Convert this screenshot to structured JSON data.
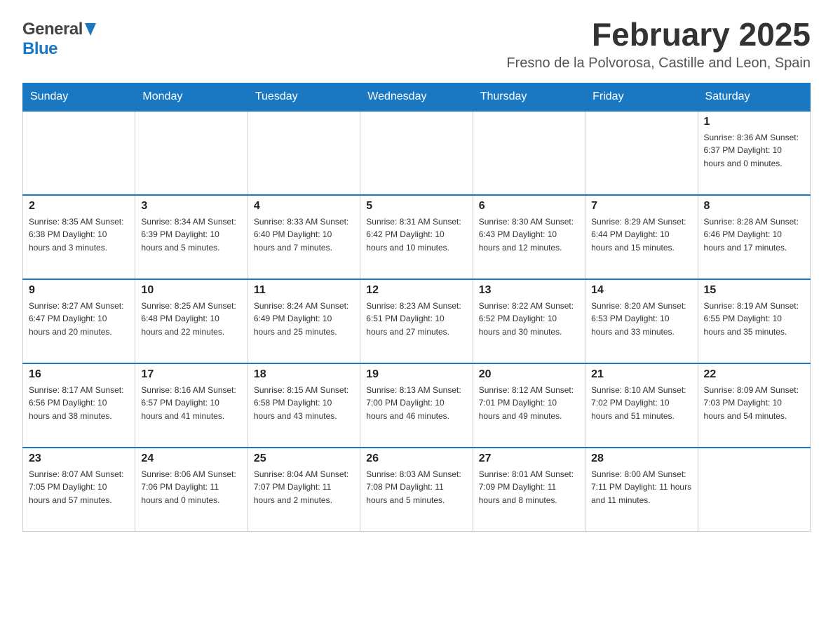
{
  "header": {
    "logo_general": "General",
    "logo_blue": "Blue",
    "month_title": "February 2025",
    "location": "Fresno de la Polvorosa, Castille and Leon, Spain"
  },
  "weekdays": [
    "Sunday",
    "Monday",
    "Tuesday",
    "Wednesday",
    "Thursday",
    "Friday",
    "Saturday"
  ],
  "weeks": [
    [
      {
        "day": "",
        "info": ""
      },
      {
        "day": "",
        "info": ""
      },
      {
        "day": "",
        "info": ""
      },
      {
        "day": "",
        "info": ""
      },
      {
        "day": "",
        "info": ""
      },
      {
        "day": "",
        "info": ""
      },
      {
        "day": "1",
        "info": "Sunrise: 8:36 AM\nSunset: 6:37 PM\nDaylight: 10 hours and 0 minutes."
      }
    ],
    [
      {
        "day": "2",
        "info": "Sunrise: 8:35 AM\nSunset: 6:38 PM\nDaylight: 10 hours and 3 minutes."
      },
      {
        "day": "3",
        "info": "Sunrise: 8:34 AM\nSunset: 6:39 PM\nDaylight: 10 hours and 5 minutes."
      },
      {
        "day": "4",
        "info": "Sunrise: 8:33 AM\nSunset: 6:40 PM\nDaylight: 10 hours and 7 minutes."
      },
      {
        "day": "5",
        "info": "Sunrise: 8:31 AM\nSunset: 6:42 PM\nDaylight: 10 hours and 10 minutes."
      },
      {
        "day": "6",
        "info": "Sunrise: 8:30 AM\nSunset: 6:43 PM\nDaylight: 10 hours and 12 minutes."
      },
      {
        "day": "7",
        "info": "Sunrise: 8:29 AM\nSunset: 6:44 PM\nDaylight: 10 hours and 15 minutes."
      },
      {
        "day": "8",
        "info": "Sunrise: 8:28 AM\nSunset: 6:46 PM\nDaylight: 10 hours and 17 minutes."
      }
    ],
    [
      {
        "day": "9",
        "info": "Sunrise: 8:27 AM\nSunset: 6:47 PM\nDaylight: 10 hours and 20 minutes."
      },
      {
        "day": "10",
        "info": "Sunrise: 8:25 AM\nSunset: 6:48 PM\nDaylight: 10 hours and 22 minutes."
      },
      {
        "day": "11",
        "info": "Sunrise: 8:24 AM\nSunset: 6:49 PM\nDaylight: 10 hours and 25 minutes."
      },
      {
        "day": "12",
        "info": "Sunrise: 8:23 AM\nSunset: 6:51 PM\nDaylight: 10 hours and 27 minutes."
      },
      {
        "day": "13",
        "info": "Sunrise: 8:22 AM\nSunset: 6:52 PM\nDaylight: 10 hours and 30 minutes."
      },
      {
        "day": "14",
        "info": "Sunrise: 8:20 AM\nSunset: 6:53 PM\nDaylight: 10 hours and 33 minutes."
      },
      {
        "day": "15",
        "info": "Sunrise: 8:19 AM\nSunset: 6:55 PM\nDaylight: 10 hours and 35 minutes."
      }
    ],
    [
      {
        "day": "16",
        "info": "Sunrise: 8:17 AM\nSunset: 6:56 PM\nDaylight: 10 hours and 38 minutes."
      },
      {
        "day": "17",
        "info": "Sunrise: 8:16 AM\nSunset: 6:57 PM\nDaylight: 10 hours and 41 minutes."
      },
      {
        "day": "18",
        "info": "Sunrise: 8:15 AM\nSunset: 6:58 PM\nDaylight: 10 hours and 43 minutes."
      },
      {
        "day": "19",
        "info": "Sunrise: 8:13 AM\nSunset: 7:00 PM\nDaylight: 10 hours and 46 minutes."
      },
      {
        "day": "20",
        "info": "Sunrise: 8:12 AM\nSunset: 7:01 PM\nDaylight: 10 hours and 49 minutes."
      },
      {
        "day": "21",
        "info": "Sunrise: 8:10 AM\nSunset: 7:02 PM\nDaylight: 10 hours and 51 minutes."
      },
      {
        "day": "22",
        "info": "Sunrise: 8:09 AM\nSunset: 7:03 PM\nDaylight: 10 hours and 54 minutes."
      }
    ],
    [
      {
        "day": "23",
        "info": "Sunrise: 8:07 AM\nSunset: 7:05 PM\nDaylight: 10 hours and 57 minutes."
      },
      {
        "day": "24",
        "info": "Sunrise: 8:06 AM\nSunset: 7:06 PM\nDaylight: 11 hours and 0 minutes."
      },
      {
        "day": "25",
        "info": "Sunrise: 8:04 AM\nSunset: 7:07 PM\nDaylight: 11 hours and 2 minutes."
      },
      {
        "day": "26",
        "info": "Sunrise: 8:03 AM\nSunset: 7:08 PM\nDaylight: 11 hours and 5 minutes."
      },
      {
        "day": "27",
        "info": "Sunrise: 8:01 AM\nSunset: 7:09 PM\nDaylight: 11 hours and 8 minutes."
      },
      {
        "day": "28",
        "info": "Sunrise: 8:00 AM\nSunset: 7:11 PM\nDaylight: 11 hours and 11 minutes."
      },
      {
        "day": "",
        "info": ""
      }
    ]
  ]
}
